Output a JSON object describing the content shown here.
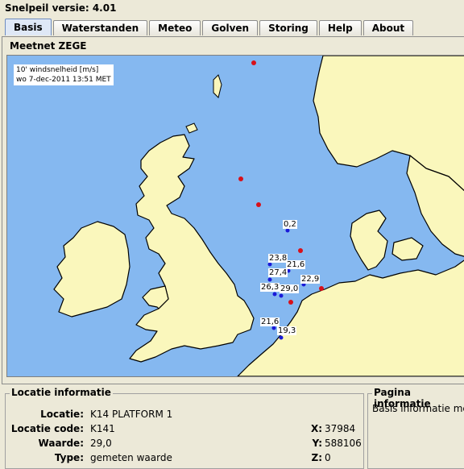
{
  "app": {
    "title": "Snelpeil versie: 4.01"
  },
  "tabs": [
    {
      "label": "Basis",
      "active": true
    },
    {
      "label": "Waterstanden",
      "active": false
    },
    {
      "label": "Meteo",
      "active": false
    },
    {
      "label": "Golven",
      "active": false
    },
    {
      "label": "Storing",
      "active": false
    },
    {
      "label": "Help",
      "active": false
    },
    {
      "label": "About",
      "active": false
    }
  ],
  "map_group": {
    "label": "Meetnet ZEGE",
    "legend": {
      "line1": "10' windsnelheid [m/s]",
      "line2": "wo 7-dec-2011 13:51 MET"
    },
    "observations": [
      "0,2",
      "23,8",
      "21,6",
      "27,4",
      "26,3",
      "29,0",
      "22,9",
      "21,6",
      "19,3"
    ],
    "colors": {
      "sea": "#85b8f0",
      "land": "#faf7bc",
      "coast": "#000000",
      "station_active": "#1a1ad8",
      "station_inactive": "#d8101a"
    }
  },
  "location_info": {
    "label": "Locatie informatie",
    "fields": [
      {
        "label": "Locatie:",
        "value": "K14 PLATFORM 1"
      },
      {
        "label": "Locatie code:",
        "value": "K141"
      },
      {
        "label": "Waarde:",
        "value": "29,0"
      },
      {
        "label": "Type:",
        "value": "gemeten waarde"
      }
    ],
    "coords": [
      {
        "label": "X:",
        "value": "37984"
      },
      {
        "label": "Y:",
        "value": "588106"
      },
      {
        "label": "Z:",
        "value": "0"
      }
    ]
  },
  "page_info": {
    "label": "Pagina informatie",
    "text": "Basis informatie mee"
  }
}
